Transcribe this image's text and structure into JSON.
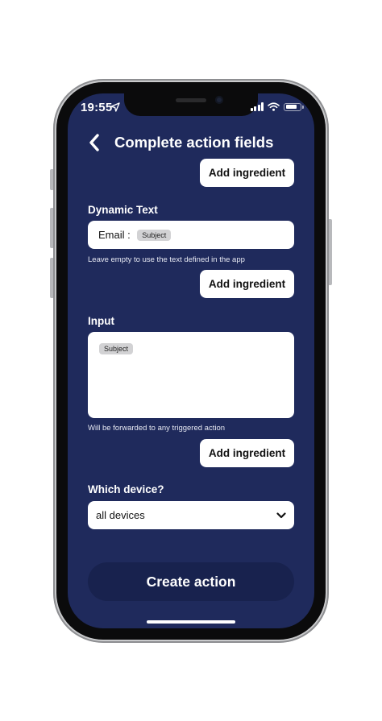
{
  "status_bar": {
    "time": "19:55",
    "location_icon": "location-arrow-icon",
    "signal_icon": "cellular-signal-icon",
    "wifi_icon": "wifi-icon",
    "battery_icon": "battery-icon",
    "battery_level": 0.8
  },
  "header": {
    "back_icon": "chevron-left-icon",
    "title": "Complete action fields"
  },
  "add_ingredient_label": "Add ingredient",
  "dynamic_text": {
    "label": "Dynamic Text",
    "prefix": "Email :",
    "chip": "Subject",
    "helper": "Leave empty to use the text defined in the app"
  },
  "input": {
    "label": "Input",
    "chip": "Subject",
    "helper": "Will be forwarded to any triggered action"
  },
  "device": {
    "label": "Which device?",
    "selected": "all devices",
    "chevron_icon": "chevron-down-icon"
  },
  "create_button": "Create action",
  "colors": {
    "screen_background": "#1f2a5c",
    "create_button_background": "#18224e",
    "field_background": "#ffffff",
    "chip_background": "#d2d2d4"
  }
}
